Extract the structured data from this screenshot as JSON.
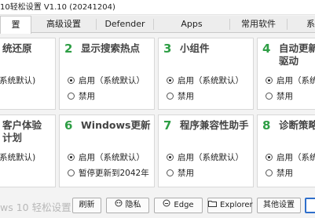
{
  "window": {
    "title": "10轻松设置 V1.10 (20241204)"
  },
  "tabs": [
    {
      "label": "置",
      "active": true
    },
    {
      "label": "高级设置",
      "active": false
    },
    {
      "label": "Defender",
      "active": false
    },
    {
      "label": "Apps",
      "active": false
    },
    {
      "label": "常用软件",
      "active": false
    },
    {
      "label": "系",
      "active": false
    }
  ],
  "cards": [
    {
      "num": "",
      "title": "统还原",
      "title2": "",
      "options": [
        "(系统默认)",
        ""
      ],
      "selected": 0
    },
    {
      "num": "2",
      "title": "显示搜索热点",
      "title2": "",
      "options": [
        "启用（系统默认）",
        "禁用"
      ],
      "selected": 0
    },
    {
      "num": "3",
      "title": "小组件",
      "title2": "",
      "options": [
        "启用（系统默认）",
        "禁用"
      ],
      "selected": 0
    },
    {
      "num": "4",
      "title": "自动更新",
      "title2": "驱动",
      "options": [
        "启用（系统",
        "禁用"
      ],
      "selected": 0
    },
    {
      "num": "",
      "title": "客户体验",
      "title2": "计划",
      "options": [
        "(系统默认)",
        ""
      ],
      "selected": 0
    },
    {
      "num": "6",
      "title": "Windows更新",
      "title2": "",
      "options": [
        "启用（系统默认）",
        "暂停更新到2042年"
      ],
      "selected": 0
    },
    {
      "num": "7",
      "title": "程序兼容性助手",
      "title2": "",
      "options": [
        "启用（系统默认）",
        "禁用"
      ],
      "selected": 0
    },
    {
      "num": "8",
      "title": "诊断策略",
      "title2": "",
      "options": [
        "启用（系统",
        "禁用"
      ],
      "selected": 0
    }
  ],
  "footer": {
    "brand": "ws 10 轻松设置",
    "buttons": [
      {
        "label": "刷新",
        "icon": ""
      },
      {
        "label": "隐私",
        "icon": "privacy-icon"
      },
      {
        "label": "Edge",
        "icon": "edge-icon"
      },
      {
        "label": "Explorer",
        "icon": "folder-icon"
      },
      {
        "label": "其他设置",
        "icon": ""
      }
    ]
  },
  "colors": {
    "accent_number": "#2e9e45",
    "primary_button_border": "#2f6fcb"
  }
}
